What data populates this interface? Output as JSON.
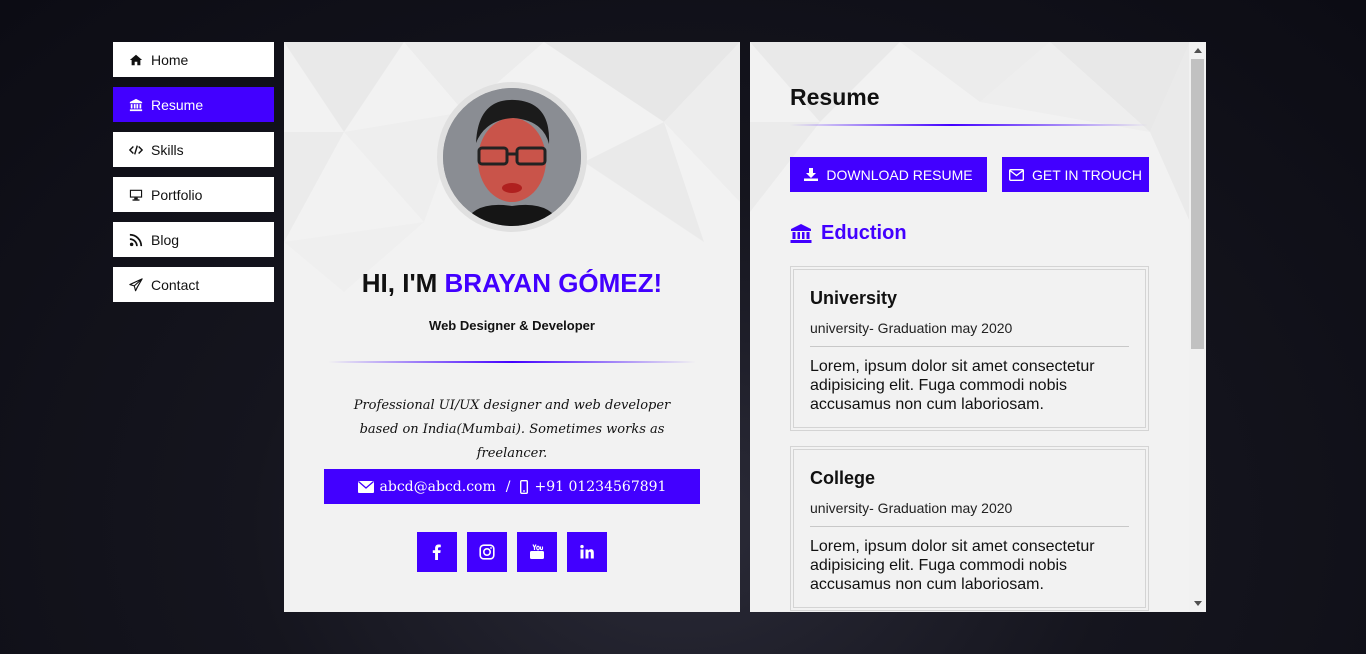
{
  "nav": {
    "items": [
      {
        "label": "Home",
        "icon": "home-icon",
        "active": false
      },
      {
        "label": "Resume",
        "icon": "bank-icon",
        "active": true
      },
      {
        "label": "Skills",
        "icon": "code-icon",
        "active": false
      },
      {
        "label": "Portfolio",
        "icon": "monitor-icon",
        "active": false
      },
      {
        "label": "Blog",
        "icon": "rss-icon",
        "active": false
      },
      {
        "label": "Contact",
        "icon": "paper-plane-icon",
        "active": false
      }
    ]
  },
  "profile": {
    "greeting_prefix": "HI, I'M ",
    "name": "BRAYAN GÓMEZ!",
    "role": "Web Designer & Developer",
    "bio": "Professional UI/UX designer and web developer based on India(Mumbai). Sometimes works as freelancer.",
    "email": "abcd@abcd.com",
    "separator": "/",
    "phone": "+91 01234567891",
    "socials": [
      "facebook-icon",
      "instagram-icon",
      "youtube-icon",
      "linkedin-icon"
    ]
  },
  "resume": {
    "title": "Resume",
    "download_label": "DOWNLOAD RESUME",
    "contact_label": "GET IN TROUCH",
    "education_heading": "Eduction",
    "education": [
      {
        "name": "University",
        "meta": "university- Graduation may 2020",
        "desc": "Lorem, ipsum dolor sit amet consectetur adipisicing elit. Fuga commodi nobis accusamus non cum laboriosam."
      },
      {
        "name": "College",
        "meta": "university- Graduation may 2020",
        "desc": "Lorem, ipsum dolor sit amet consectetur adipisicing elit. Fuga commodi nobis accusamus non cum laboriosam."
      }
    ]
  },
  "colors": {
    "accent": "#4200ff",
    "panel": "#f2f2f2",
    "background": "#15151e"
  }
}
